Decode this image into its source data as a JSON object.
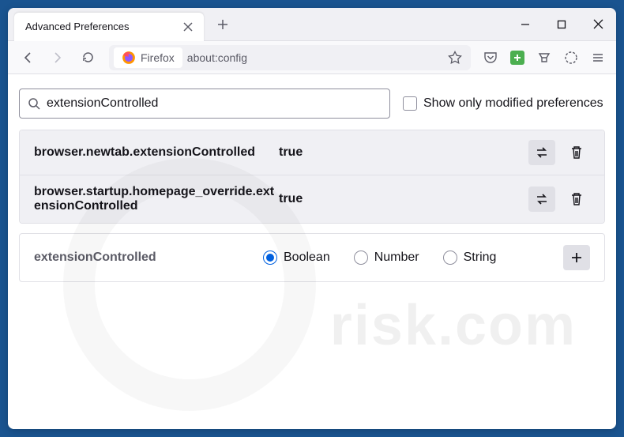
{
  "tab": {
    "title": "Advanced Preferences"
  },
  "urlbar": {
    "identity": "Firefox",
    "url": "about:config"
  },
  "search": {
    "value": "extensionControlled",
    "checkbox_label": "Show only modified preferences"
  },
  "prefs": [
    {
      "name": "browser.newtab.extensionControlled",
      "value": "true"
    },
    {
      "name": "browser.startup.homepage_override.extensionControlled",
      "value": "true"
    }
  ],
  "new_pref": {
    "name": "extensionControlled",
    "types": [
      "Boolean",
      "Number",
      "String"
    ],
    "selected": 0
  },
  "watermark": "risk.com"
}
